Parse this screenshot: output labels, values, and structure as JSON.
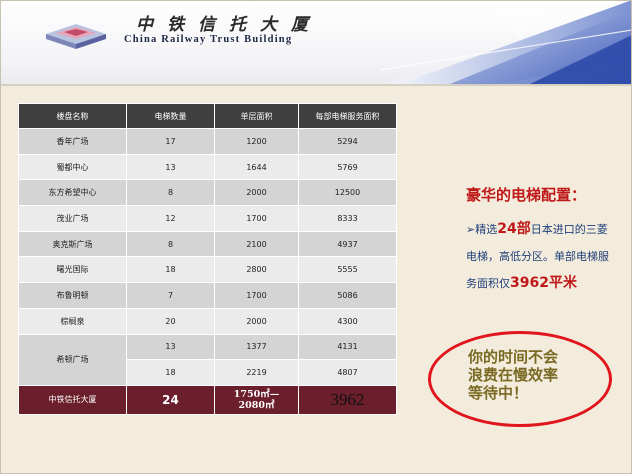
{
  "header": {
    "logo_cn": "中铁信托大厦",
    "logo_en": "China Railway Trust Building"
  },
  "table": {
    "columns": [
      "楼盘名称",
      "电梯数量",
      "单层面积",
      "每部电梯服务面积"
    ],
    "rows": [
      {
        "name": "香年广场",
        "elevators": "17",
        "floor_area": "1200",
        "service_area": "5294"
      },
      {
        "name": "蜀都中心",
        "elevators": "13",
        "floor_area": "1644",
        "service_area": "5769"
      },
      {
        "name": "东方希望中心",
        "elevators": "8",
        "floor_area": "2000",
        "service_area": "12500"
      },
      {
        "name": "茂业广场",
        "elevators": "12",
        "floor_area": "1700",
        "service_area": "8333"
      },
      {
        "name": "奥克斯广场",
        "elevators": "8",
        "floor_area": "2100",
        "service_area": "4937"
      },
      {
        "name": "曙光国际",
        "elevators": "18",
        "floor_area": "2800",
        "service_area": "5555"
      },
      {
        "name": "布鲁明顿",
        "elevators": "7",
        "floor_area": "1700",
        "service_area": "5086"
      },
      {
        "name": "棕榈泉",
        "elevators": "20",
        "floor_area": "2000",
        "service_area": "4300"
      }
    ],
    "merged_row": {
      "name": "希顿广场",
      "sub": [
        {
          "elevators": "13",
          "floor_area": "1377",
          "service_area": "4131"
        },
        {
          "elevators": "18",
          "floor_area": "2219",
          "service_area": "4807"
        }
      ]
    },
    "total": {
      "name": "中铁信托大厦",
      "elevators": "24",
      "floor_area_line1": "1750㎡—",
      "floor_area_line2": "2080㎡",
      "service_area": "3962"
    }
  },
  "panel": {
    "heading": "豪华的电梯配置：",
    "p1": "➢精选",
    "p1_hl": "24部",
    "p2": "日本进口的三菱电梯，高低分区。单部电梯服务面积仅",
    "p2_hl": "3962平米",
    "callout_line1": "你的时间不会",
    "callout_line2": "浪费在慢效率",
    "callout_line3": "等待中！"
  },
  "colors": {
    "header_row": "#3f3f3f",
    "total_row": "#6b1e2c",
    "accent_red": "#c01818",
    "body_blue": "#1f3f7a",
    "callout_olive": "#7a6a24"
  }
}
